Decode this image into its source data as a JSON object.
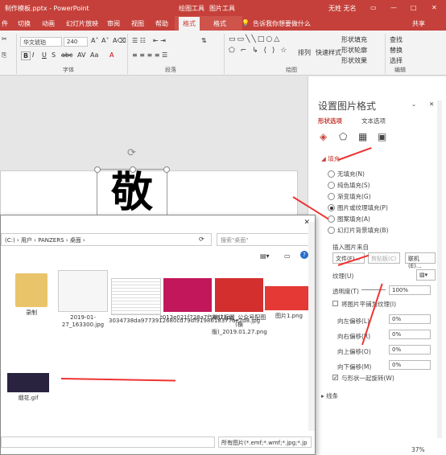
{
  "window": {
    "doc_title": "制作模板.pptx - PowerPoint",
    "ctx_tab1": "绘图工具",
    "ctx_tab2": "图片工具",
    "user": "无姓 无名"
  },
  "tabs": [
    "件",
    "切换",
    "动画",
    "幻灯片放映",
    "审阅",
    "视图",
    "帮助",
    "格式",
    "格式"
  ],
  "tell_me": "告诉我你想要做什么",
  "share": "共享",
  "ribbon": {
    "font_name": "华文琥珀",
    "font_size": "240",
    "group_font": "字体",
    "group_paragraph": "段落",
    "group_drawing": "绘图",
    "group_edit": "编辑",
    "arrange": "排列",
    "quick_styles": "快速样式",
    "shape_fill": "形状填充",
    "shape_outline": "形状轮廓",
    "shape_effects": "形状效果",
    "find": "查找",
    "replace": "替换",
    "select": "选择"
  },
  "slide": {
    "big_char": "敬"
  },
  "pane": {
    "title": "设置图片格式",
    "tab_shape": "形状选项",
    "tab_text": "文本选项",
    "section_fill": "填充",
    "fill_options": [
      "无填充(N)",
      "纯色填充(S)",
      "渐变填充(G)",
      "图片或纹理填充(P)",
      "图案填充(A)",
      "幻灯片背景填充(B)"
    ],
    "fill_selected": 3,
    "insert_from": "插入图片来自",
    "btn_file": "文件(F)...",
    "btn_clip": "剪贴板(C)",
    "btn_online": "联机(E)...",
    "texture": "纹理(U)",
    "transparency_label": "透明度(T)",
    "transparency_value": "100%",
    "tile_label": "将图片平铺为纹理(I)",
    "offsets": [
      {
        "label": "向左偏移(L)",
        "value": "0%"
      },
      {
        "label": "向右偏移(R)",
        "value": "0%"
      },
      {
        "label": "向上偏移(O)",
        "value": "0%"
      },
      {
        "label": "向下偏移(M)",
        "value": "0%"
      }
    ],
    "rotate_label": "与形状一起旋转(W)",
    "section_line": "线条",
    "zoom": "37%"
  },
  "dialog": {
    "path": "(C:) › 用户 › PANZERS › 桌面 ›",
    "search_placeholder": "搜索\"桌面\"",
    "files": [
      {
        "name": "录制"
      },
      {
        "name": "2019-01-27_163300.jpg"
      },
      {
        "name": "3034738da9773912680cd79df9198618377ae2d8.jpg"
      },
      {
        "name": "t013e021f728a7f5487.jpg"
      },
      {
        "name": "默认标题_公众号配图(横版)_2019.01.27.png"
      },
      {
        "name": "图片1.png"
      },
      {
        "name": "烟花.gif"
      }
    ],
    "filter": "所有图片(*.emf;*.wmf;*.jpg;*.jp"
  },
  "colors": {
    "accent": "#c5403a",
    "arrow": "#e33333"
  }
}
